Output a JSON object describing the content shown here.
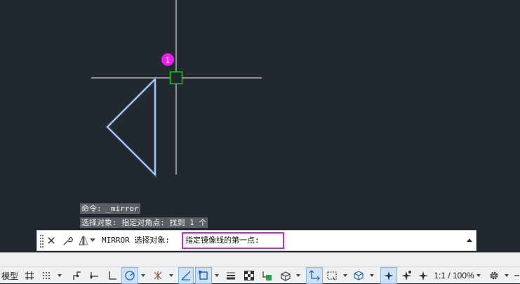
{
  "colors": {
    "canvas_bg": "#212830",
    "crosshair": "#ffffff",
    "triangle": "#a8c8ff",
    "pick_box": "#1fc41f",
    "marker": "#e620e6",
    "input_border": "#c92bd6"
  },
  "marker_label": "1",
  "history": {
    "line1": "命令: _mirror",
    "line2": "选择对象: 指定对角点: 找到 1 个"
  },
  "command_bar": {
    "prompt": "MIRROR 选择对象:",
    "input_text": "指定镜像线的第一点:",
    "icons": [
      "grip-handle-icon",
      "close-icon",
      "wrench-icon",
      "mirror-command-icon",
      "dropdown-arrow-icon",
      "scroll-up-icon"
    ]
  },
  "status_bar": {
    "model_label": "模型",
    "scale_label": "1:1 / 100%",
    "icons": [
      "grid-icon",
      "snap-icon",
      "infer-constraints-icon",
      "dynamic-ucs-icon",
      "ortho-icon",
      "polar-tracking-icon",
      "isodraft-icon",
      "object-snap-tracking-icon",
      "object-snap-icon",
      "lineweight-icon",
      "transparency-icon",
      "selection-cycling-icon",
      "3d-osnap-icon",
      "dynamic-input-icon",
      "selection-filter-icon",
      "gizmo-icon",
      "annotation-visibility-icon",
      "auto-scale-icon",
      "annotation-scale-icon",
      "settings-gear-icon"
    ]
  }
}
